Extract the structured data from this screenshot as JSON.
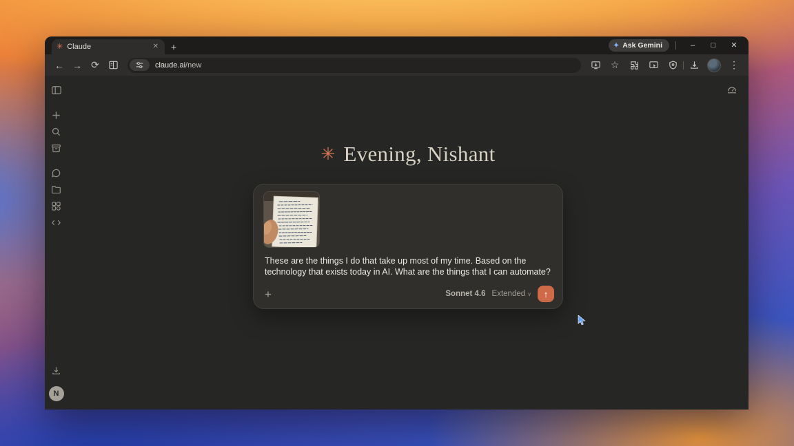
{
  "window": {
    "tab_title": "Claude",
    "ask_gemini_label": "Ask Gemini",
    "url": {
      "host": "claude.ai",
      "path": "/new"
    }
  },
  "glyphs": {
    "favicon": "✳",
    "new_tab": "+",
    "tab_close": "✕",
    "minimize": "–",
    "maximize": "□",
    "close": "✕",
    "back": "←",
    "forward": "→",
    "reload": "⟳",
    "star": "☆",
    "kebab_menu": "⋮",
    "gemini_sparkle": "✦",
    "plus": "+",
    "chevron_down": "∨",
    "send_arrow": "↑",
    "greeting_spark": "✳"
  },
  "page": {
    "greeting": "Evening, Nishant",
    "composer": {
      "message": "These are the things I do that take up most of my time. Based on the technology that exists today in AI. What are the things that I can automate?",
      "model": "Sonnet 4.6",
      "mode": "Extended",
      "attachment": "handwritten-notes-photo"
    },
    "profile_initial": "N"
  },
  "colors": {
    "accent": "#d97757",
    "page_bg": "#262624",
    "composer_bg": "#302f2c",
    "send_button": "#cf6a49"
  }
}
